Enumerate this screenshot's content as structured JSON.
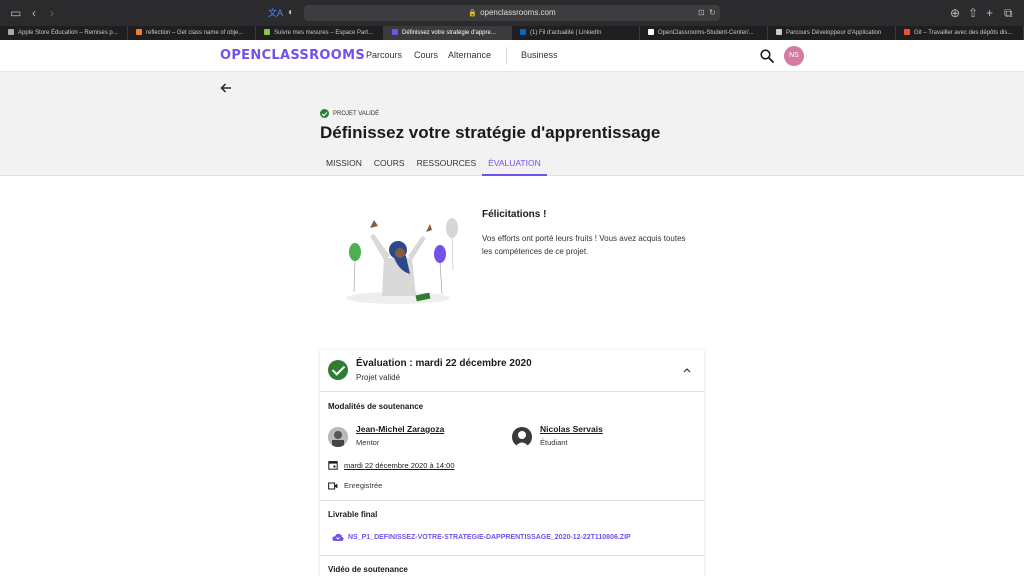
{
  "browser": {
    "url": "openclassrooms.com",
    "tabs": [
      {
        "label": "Apple Store Éducation – Remises p...",
        "color": "#aaaaaa",
        "active": false
      },
      {
        "label": "reflection – Get class name of obje...",
        "color": "#f48024",
        "active": false
      },
      {
        "label": "Suivre mes mesures – Espace Part...",
        "color": "#8bc34a",
        "active": false
      },
      {
        "label": "Définissez votre stratégie d'appre...",
        "color": "#7451eb",
        "active": true
      },
      {
        "label": "(1) Fil d'actualité | LinkedIn",
        "color": "#0a66c2",
        "active": false
      },
      {
        "label": "OpenClassrooms-Student-Center/...",
        "color": "#ffffff",
        "active": false
      },
      {
        "label": "Parcours Développeur d'Application",
        "color": "#cccccc",
        "active": false
      },
      {
        "label": "Git – Travailler avec des dépôts dis...",
        "color": "#f05133",
        "active": false
      }
    ]
  },
  "header": {
    "logo": "OPENCLASSROOMS",
    "nav": [
      "Parcours",
      "Cours",
      "Alternance",
      "Business"
    ],
    "avatar_initials": "NS"
  },
  "hero": {
    "badge": "PROJET VALIDÉ",
    "title": "Définissez votre stratégie d'apprentissage",
    "tabs": [
      "MISSION",
      "COURS",
      "RESSOURCES",
      "ÉVALUATION"
    ],
    "active_tab": "ÉVALUATION"
  },
  "congrats": {
    "title": "Félicitations !",
    "text": "Vos efforts ont porté leurs fruits ! Vous avez acquis toutes les compétences de ce projet."
  },
  "evaluation": {
    "title": "Évaluation : mardi 22 décembre 2020",
    "status": "Projet validé",
    "modalities_label": "Modalités de soutenance",
    "mentor": {
      "name": "Jean-Michel Zaragoza",
      "role": "Mentor"
    },
    "student": {
      "name": "Nicolas Servais",
      "role": "Étudiant"
    },
    "date": "mardi 22 décembre 2020 à 14:00",
    "recording": "Enregistrée",
    "deliverable_label": "Livrable final",
    "deliverable_file": "NS_P1_DEFINISSEZ-VOTRE-STRATEGIE-DAPPRENTISSAGE_2020-12-22T110806.ZIP",
    "video_label": "Vidéo de soutenance"
  },
  "colors": {
    "brand": "#7451eb",
    "success": "#2e7d32",
    "avatar": "#d57aa0"
  }
}
